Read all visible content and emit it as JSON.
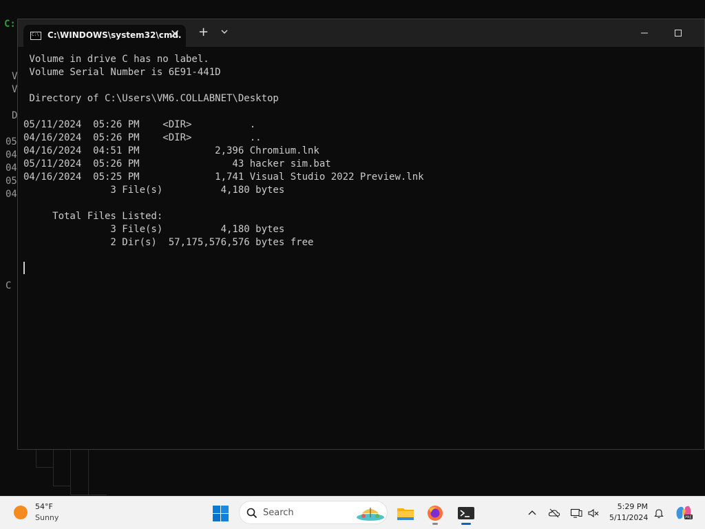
{
  "background_window": {
    "edge_chars": [
      "V",
      "V",
      "D",
      "05",
      "04",
      "04",
      "05",
      "04",
      "C"
    ],
    "edge_prompt": "C:"
  },
  "terminal": {
    "tab_title": "C:\\WINDOWS\\system32\\cmd.",
    "tab_close": "✕",
    "new_tab": "+",
    "lines": [
      " Volume in drive C has no label.",
      " Volume Serial Number is 6E91-441D",
      "",
      " Directory of C:\\Users\\VM6.COLLABNET\\Desktop",
      "",
      "05/11/2024  05:26 PM    <DIR>          .",
      "04/16/2024  05:26 PM    <DIR>          ..",
      "04/16/2024  04:51 PM             2,396 Chromium.lnk",
      "05/11/2024  05:26 PM                43 hacker sim.bat",
      "04/16/2024  05:25 PM             1,741 Visual Studio 2022 Preview.lnk",
      "               3 File(s)          4,180 bytes",
      "",
      "     Total Files Listed:",
      "               3 File(s)          4,180 bytes",
      "               2 Dir(s)  57,175,576,576 bytes free"
    ]
  },
  "taskbar": {
    "weather": {
      "temp": "54°F",
      "condition": "Sunny"
    },
    "search_label": "Search",
    "clock": {
      "time": "5:29 PM",
      "date": "5/11/2024"
    },
    "colors": {
      "accent": "#0067c0",
      "weather_sun": "#f58a1f",
      "file_explorer": "#f4b400"
    }
  }
}
